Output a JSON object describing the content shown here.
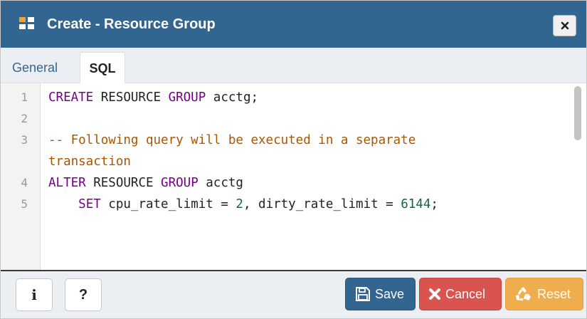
{
  "dialog": {
    "title": "Create - Resource Group",
    "title_icon": "resource-group-icon",
    "close_icon": "close-icon"
  },
  "tabs": [
    {
      "label": "General",
      "active": false
    },
    {
      "label": "SQL",
      "active": true
    }
  ],
  "editor": {
    "lines": [
      {
        "num": "1",
        "tokens": [
          {
            "t": "CREATE",
            "c": "kw"
          },
          {
            "t": " RESOURCE ",
            "c": ""
          },
          {
            "t": "GROUP",
            "c": "kw"
          },
          {
            "t": " acctg;",
            "c": ""
          }
        ]
      },
      {
        "num": "2",
        "tokens": []
      },
      {
        "num": "3",
        "tokens": [
          {
            "t": "-- Following query will be executed in a separate",
            "c": "cm"
          }
        ]
      },
      {
        "num": "",
        "tokens": [
          {
            "t": "transaction",
            "c": "cm"
          }
        ]
      },
      {
        "num": "4",
        "tokens": [
          {
            "t": "ALTER",
            "c": "kw"
          },
          {
            "t": " RESOURCE ",
            "c": ""
          },
          {
            "t": "GROUP",
            "c": "kw"
          },
          {
            "t": " acctg",
            "c": ""
          }
        ]
      },
      {
        "num": "5",
        "tokens": [
          {
            "t": "    ",
            "c": ""
          },
          {
            "t": "SET",
            "c": "kw"
          },
          {
            "t": " cpu_rate_limit = ",
            "c": ""
          },
          {
            "t": "2",
            "c": "num"
          },
          {
            "t": ", dirty_rate_limit = ",
            "c": ""
          },
          {
            "t": "6144",
            "c": "num"
          },
          {
            "t": ";",
            "c": ""
          }
        ]
      }
    ]
  },
  "footer": {
    "info_label": "i",
    "help_label": "?",
    "save_label": "Save",
    "cancel_label": "Cancel",
    "reset_label": "Reset"
  },
  "colors": {
    "titlebar": "#326690",
    "save": "#326690",
    "cancel": "#d9534f",
    "reset": "#f0ad4e",
    "keyword": "#770088",
    "comment": "#aa5500",
    "number": "#116644"
  }
}
